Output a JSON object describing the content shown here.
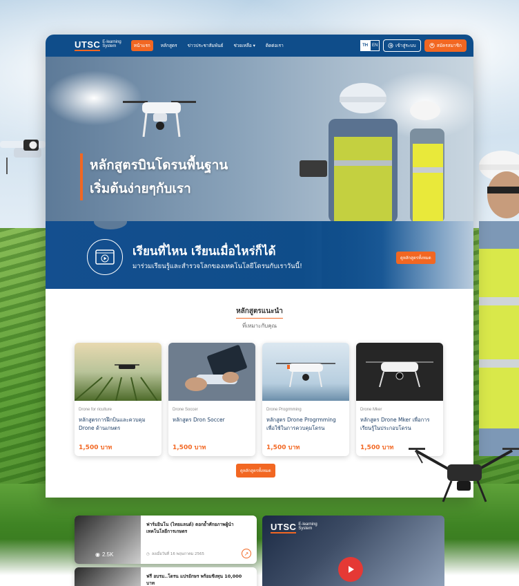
{
  "colors": {
    "brand_blue": "#0f4d8a",
    "accent_orange": "#f26722",
    "price_orange": "#f26722"
  },
  "brand": {
    "logo_main": "UTSC",
    "logo_sub_1": "E-learning",
    "logo_sub_2": "System"
  },
  "nav": {
    "items": [
      {
        "label": "หน้าแรก",
        "active": true
      },
      {
        "label": "หลักสูตร"
      },
      {
        "label": "ข่าวประชาสัมพันธ์"
      },
      {
        "label": "ช่วยเหลือ"
      },
      {
        "label": "ติดต่อเรา"
      }
    ],
    "lang_th": "TH",
    "lang_en": "EN",
    "login": "เข้าสู่ระบบ",
    "register": "สมัครสมาชิก"
  },
  "hero": {
    "line1": "หลักสูตรบินโดรนพื้นฐาน",
    "line2": "เริ่มต้นง่ายๆกับเรา"
  },
  "banner": {
    "title": "เรียนที่ไหน เรียนเมื่อไหร่ก็ได้",
    "subtitle": "มาร่วมเรียนรู้และสำรวจโลกของเทคโนโลยีโดรนกับเราวันนี้!",
    "button": "ดูหลักสูตรทั้งหมด"
  },
  "recommended": {
    "title": "หลักสูตรแนะนำ",
    "subtitle": "ที่เหมาะกับคุณ",
    "cards": [
      {
        "category": "Drone for riculture",
        "title": "หลักสูตรการฝึกบินและควบคุม Drone ด้านเกษตร",
        "price": "1,500 บาท"
      },
      {
        "category": "Drone Soccer",
        "title": "หลักสูตร Dron Soccer",
        "price": "1,500 บาท"
      },
      {
        "category": "Drone Progrmming",
        "title": "หลักสูตร Drone Progrmming เพื่อใช้ในการควบคุมโดรน",
        "price": "1,500 บาท"
      },
      {
        "category": "Drone Mker",
        "title": "หลักสูตร Drone Mker เพื่อการเรียนรู้ในประกอบโดรน",
        "price": "1,500 บาท"
      }
    ],
    "all_button": "ดูหลักสูตรทั้งหมด"
  },
  "news": {
    "item1": {
      "title": "ฟาร์มอินโน (ไทยแลนด์) ตอกย้ำศักยภาพผู้นำเทคโนโลยีการเกษตร",
      "views": "2.5K",
      "date": "ลงเมื่อวันที่ 16 พฤษภาคม 2565"
    },
    "item2": {
      "title": "ฟรี อบรม..โดรน แปรอักษร พร้อมชิงทุน 10,000 บาท"
    }
  },
  "video": {
    "logo_main": "UTSC",
    "logo_sub_1": "E-learning",
    "logo_sub_2": "System"
  }
}
